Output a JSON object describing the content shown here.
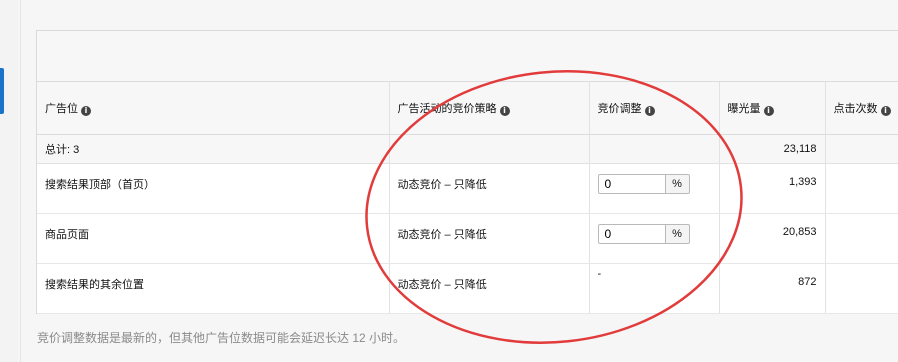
{
  "table": {
    "headers": [
      "广告位",
      "广告活动的竞价策略",
      "竞价调整",
      "曝光量",
      "点击次数"
    ],
    "total": {
      "label": "总计: 3",
      "impressions": "23,118"
    },
    "rows": [
      {
        "placement": "搜索结果顶部（首页）",
        "strategy": "动态竞价 – 只降低",
        "adjustment": "0",
        "unit": "%",
        "impressions": "1,393"
      },
      {
        "placement": "商品页面",
        "strategy": "动态竞价 – 只降低",
        "adjustment": "0",
        "unit": "%",
        "impressions": "20,853"
      },
      {
        "placement": "搜索结果的其余位置",
        "strategy": "动态竞价 – 只降低",
        "adjustment": "-",
        "impressions": "872"
      }
    ]
  },
  "info_icon_glyph": "i",
  "footnote": "竞价调整数据是最新的，但其他广告位数据可能会延迟长达 12 小时。",
  "colors": {
    "accent": "#1a73c9",
    "annotation_circle": "#e23b3b"
  }
}
